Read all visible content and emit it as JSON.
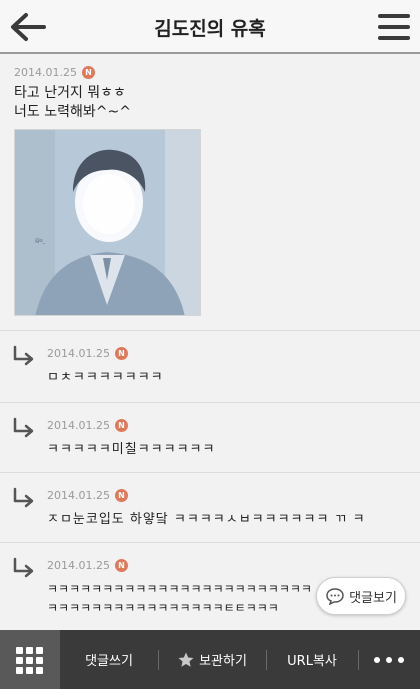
{
  "header": {
    "title": "김도진의 유혹",
    "back_icon": "back-arrow-icon",
    "menu_icon": "hamburger-menu-icon"
  },
  "post": {
    "date": "2014.01.25",
    "badge": "N",
    "text_lines": [
      "타고 난거지 뭐ㅎㅎ",
      "너도 노력해봐^~^"
    ],
    "image_alt": "photo"
  },
  "replies": [
    {
      "date": "2014.01.25",
      "badge": "N",
      "lines": [
        "ㅁㅊㅋㅋㅋㅋㅋㅋㅋ"
      ]
    },
    {
      "date": "2014.01.25",
      "badge": "N",
      "lines": [
        "ㅋㅋㅋㅋㅋ미칠ㅋㅋㅋㅋㅋㅋ"
      ]
    },
    {
      "date": "2014.01.25",
      "badge": "N",
      "lines": [
        "ㅈㅁ눈코입도 하얗닼 ㅋㅋㅋㅋㅅㅂㅋㅋㅋㅋㅋㅋ ㄲ ㅋ"
      ]
    },
    {
      "date": "2014.01.25",
      "badge": "N",
      "lines": [
        "ㅋㅋㅋㅋㅋㅋㅋㅋㅋㅋㅋㅋㅋㅋㅋㅋㅋㅋㅋㅋㅋㅋㅋㅋ",
        "ㅋㅋㅋㅋㅋㅋㅋㅋㅋㅋㅋㅋㅋㅋㅋㅋㅌㅌㅋㅋㅋ"
      ]
    }
  ],
  "float_button": {
    "label": "댓글보기",
    "icon": "chat-bubble-icon"
  },
  "bottom_bar": {
    "grid_icon": "grid-menu-icon",
    "comment_label": "댓글쓰기",
    "bookmark_label": "보관하기",
    "bookmark_icon": "star-icon",
    "url_label": "URL복사",
    "more_icon": "more-dots-icon"
  },
  "colors": {
    "badge": "#e0785a",
    "bottom_bar": "#3a3a3a",
    "header_border": "#9a9a9a"
  }
}
